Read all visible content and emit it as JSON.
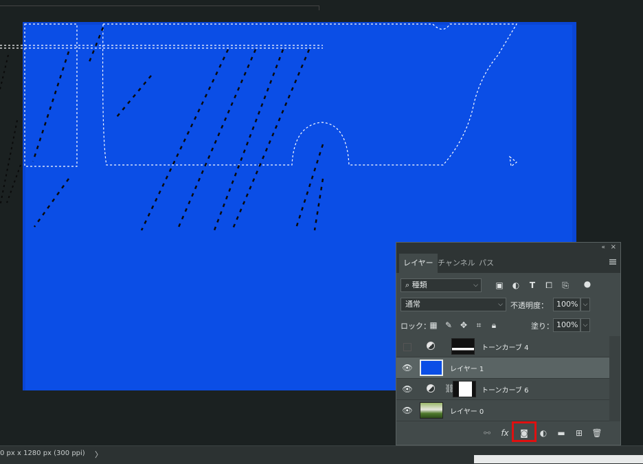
{
  "status": {
    "doc_info": "0 px x 1280 px (300 ppi)",
    "arrow": "〉"
  },
  "panel": {
    "collapse_icon": "«",
    "close_icon": "×",
    "tabs": [
      {
        "label": "レイヤー",
        "active": true
      },
      {
        "label": "チャンネル",
        "active": false
      },
      {
        "label": "パス",
        "active": false
      }
    ],
    "filter": {
      "label": "種類",
      "search_icon": "⌕",
      "chevron": "⌵"
    },
    "filter_icons": [
      "image-filter-icon",
      "adjustment-filter-icon",
      "type-filter-icon",
      "shape-filter-icon",
      "smart-object-filter-icon",
      "filter-toggle-icon"
    ],
    "blend_mode": "通常",
    "opacity_label": "不透明度：",
    "opacity_value": "100%",
    "lock_label": "ロック：",
    "fill_label": "塗り：",
    "fill_value": "100%",
    "layers": [
      {
        "name": "トーンカーブ 4",
        "visible": false,
        "type": "adjustment",
        "selected": false
      },
      {
        "name": "レイヤー 1",
        "visible": true,
        "type": "pixel",
        "selected": true
      },
      {
        "name": "トーンカーブ 6",
        "visible": true,
        "type": "adjustment",
        "selected": false
      },
      {
        "name": "レイヤー 0",
        "visible": true,
        "type": "image",
        "selected": false
      }
    ],
    "footer_icons": [
      "link-layers-icon",
      "fx-icon",
      "add-layer-mask-icon",
      "new-adjustment-icon",
      "new-group-icon",
      "new-layer-icon",
      "delete-layer-icon"
    ],
    "fx_label": "fx"
  },
  "colors": {
    "canvas_blue": "#0b4ee6",
    "highlight_red": "#e01010",
    "panel_bg": "#424a4a"
  }
}
